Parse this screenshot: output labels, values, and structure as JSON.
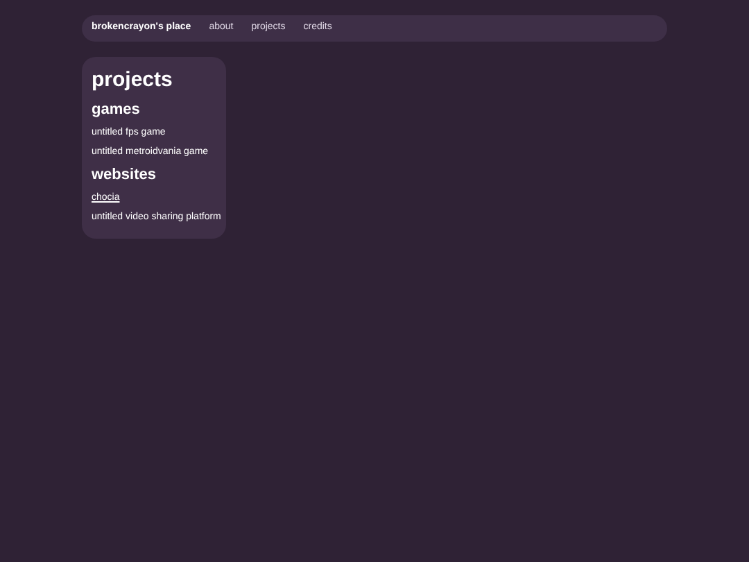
{
  "nav": {
    "brand": "brokencrayon's place",
    "links": [
      "about",
      "projects",
      "credits"
    ]
  },
  "card": {
    "title": "projects",
    "sections": [
      {
        "heading": "games",
        "items": [
          {
            "text": "untitled fps game",
            "kind": "text"
          },
          {
            "text": "untitled metroidvania game",
            "kind": "text"
          }
        ]
      },
      {
        "heading": "websites",
        "items": [
          {
            "text": "chocia",
            "kind": "link"
          },
          {
            "text": "untitled video sharing platform",
            "kind": "text"
          }
        ]
      }
    ]
  }
}
